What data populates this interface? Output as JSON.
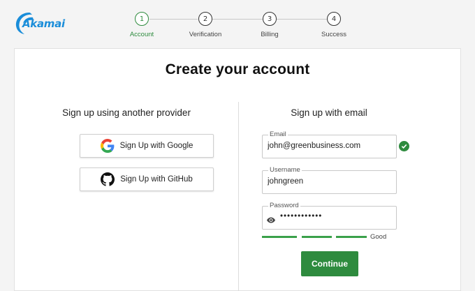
{
  "brand": {
    "name": "Akamai",
    "color": "#1a8dd9"
  },
  "steps": [
    {
      "number": "1",
      "label": "Account",
      "active": true
    },
    {
      "number": "2",
      "label": "Verification",
      "active": false
    },
    {
      "number": "3",
      "label": "Billing",
      "active": false
    },
    {
      "number": "4",
      "label": "Success",
      "active": false
    }
  ],
  "page": {
    "title": "Create your account"
  },
  "providers": {
    "heading": "Sign up using another provider",
    "google_label": "Sign Up with Google",
    "github_label": "Sign Up with GitHub"
  },
  "email_signup": {
    "heading": "Sign up with email",
    "email": {
      "label": "Email",
      "value": "john@greenbusiness.com",
      "valid": true
    },
    "username": {
      "label": "Username",
      "value": "johngreen"
    },
    "password": {
      "label": "Password",
      "value": "••••••••••••"
    },
    "strength": {
      "level": 3,
      "max": 3,
      "label": "Good"
    },
    "continue_label": "Continue"
  },
  "colors": {
    "accent": "#2e8b3e",
    "strength": "#3aa14a"
  }
}
